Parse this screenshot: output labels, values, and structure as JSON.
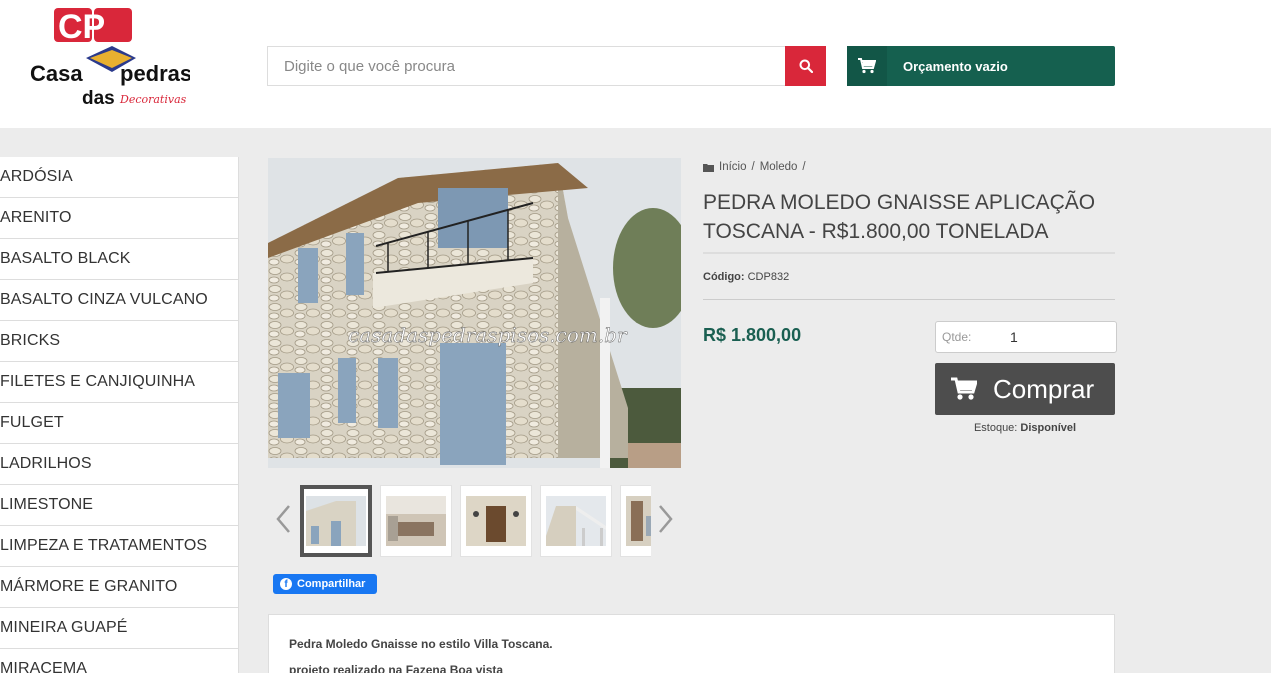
{
  "header": {
    "logo_letters": "CP",
    "logo_word1": "Casa",
    "logo_word2": "pedras",
    "logo_word3": "das",
    "logo_word4": "Decorativas",
    "search": {
      "placeholder": "Digite o que você procura",
      "icon": "search-icon"
    },
    "quote_button": {
      "label": "Orçamento vazio",
      "icon": "cart-icon"
    }
  },
  "sidebar": {
    "items": [
      {
        "label": "ARDÓSIA"
      },
      {
        "label": "ARENITO"
      },
      {
        "label": "BASALTO BLACK"
      },
      {
        "label": "BASALTO CINZA VULCANO"
      },
      {
        "label": "BRICKS"
      },
      {
        "label": "FILETES E CANJIQUINHA"
      },
      {
        "label": "FULGET"
      },
      {
        "label": "LADRILHOS"
      },
      {
        "label": "LIMESTONE"
      },
      {
        "label": "LIMPEZA E TRATAMENTOS"
      },
      {
        "label": "MÁRMORE E GRANITO"
      },
      {
        "label": "MINEIRA GUAPÉ"
      },
      {
        "label": "MIRACEMA"
      }
    ]
  },
  "gallery": {
    "watermark": "casadaspedraspisos.com.br",
    "thumbnails_visible": 5,
    "active_thumbnail": 0,
    "share_label": "Compartilhar"
  },
  "breadcrumb": {
    "home": "Início",
    "category": "Moledo",
    "separator": "/"
  },
  "product": {
    "title": "PEDRA MOLEDO GNAISSE APLICAÇÃO TOSCANA - R$1.800,00 TONELADA",
    "code_label": "Código:",
    "code": "CDP832",
    "price": "R$ 1.800,00",
    "qty_label": "Qtde:",
    "qty_value": "1",
    "buy_label": "Comprar",
    "stock_label": "Estoque:",
    "stock_value": "Disponível"
  },
  "description": {
    "line1": "Pedra Moledo Gnaisse no estilo Villa Toscana.",
    "line2": "projeto realizado na Fazena Boa vista"
  },
  "colors": {
    "brand_green": "#15604f",
    "search_red": "#d9273a",
    "buy_gray": "#4d4d4d",
    "price_green": "#1a5f51",
    "facebook_blue": "#1877f2"
  }
}
